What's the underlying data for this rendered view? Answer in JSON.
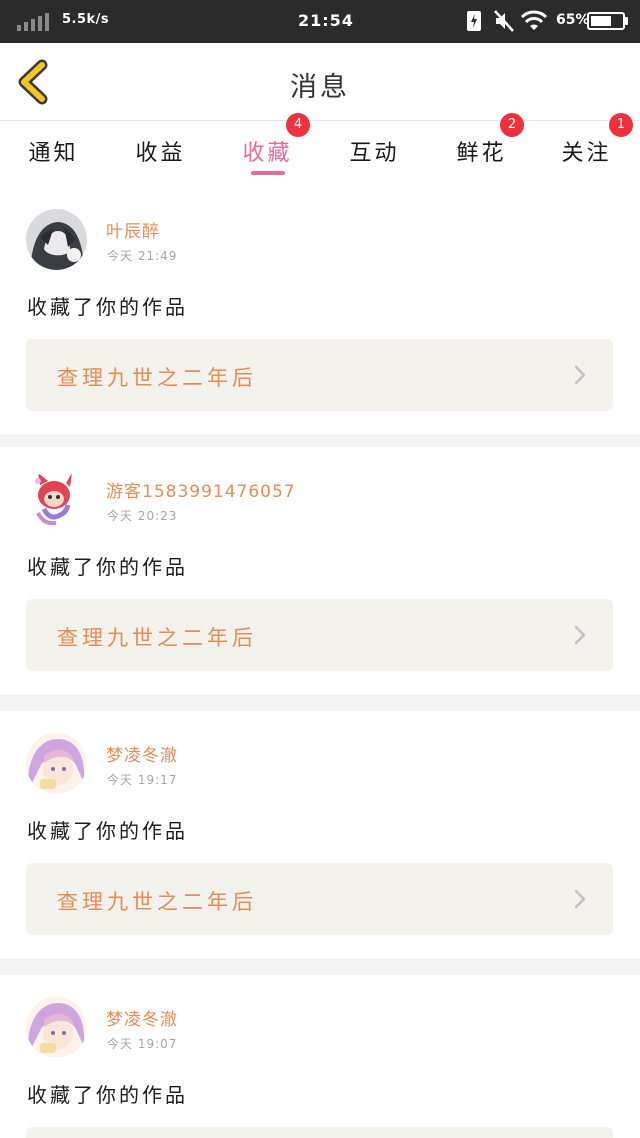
{
  "status_bar": {
    "net_speed": "5.5k/s",
    "time": "21:54",
    "battery_percent": "65%",
    "battery_level": 0.65,
    "icons": [
      "signal-icon",
      "charging-icon",
      "mute-icon",
      "wifi-icon",
      "battery-icon"
    ]
  },
  "header": {
    "title": "消息",
    "back_icon": "chevron-left-icon"
  },
  "tabs": [
    {
      "label": "通知",
      "badge": ""
    },
    {
      "label": "收益",
      "badge": ""
    },
    {
      "label": "收藏",
      "badge": "4",
      "active": true
    },
    {
      "label": "互动",
      "badge": ""
    },
    {
      "label": "鲜花",
      "badge": "2"
    },
    {
      "label": "关注",
      "badge": "1"
    }
  ],
  "messages": [
    {
      "username": "叶辰醉",
      "time": "今天 21:49",
      "text": "收藏了你的作品",
      "work_title": "查理九世之二年后",
      "avatar": "avatar-dark-hair"
    },
    {
      "username": "游客1583991476057",
      "time": "今天 20:23",
      "text": "收藏了你的作品",
      "work_title": "查理九世之二年后",
      "avatar": "avatar-red-mascot"
    },
    {
      "username": "梦凌冬澈",
      "time": "今天 19:17",
      "text": "收藏了你的作品",
      "work_title": "查理九世之二年后",
      "avatar": "avatar-pink-hair"
    },
    {
      "username": "梦凌冬澈",
      "time": "今天 19:07",
      "text": "收藏了你的作品",
      "work_title": "",
      "avatar": "avatar-pink-hair"
    }
  ],
  "colors": {
    "accent": "#e8699a",
    "name": "#e88c55",
    "badge": "#f0303c",
    "back": "#f3c623"
  }
}
